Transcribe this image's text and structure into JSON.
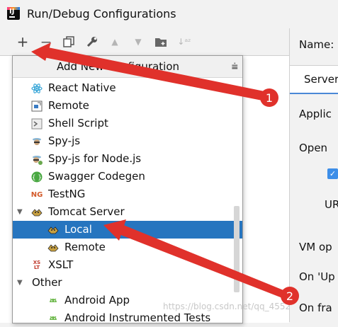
{
  "window": {
    "title": "Run/Debug Configurations"
  },
  "toolbar": {
    "icons": [
      "plus-icon",
      "minus-icon",
      "copy-icon",
      "wrench-icon",
      "arrow-up-icon",
      "arrow-down-icon",
      "folder-icon",
      "sort-icon"
    ]
  },
  "popup": {
    "title": "Add New Configuration",
    "items": [
      {
        "label": "React Native",
        "icon": "react-icon"
      },
      {
        "label": "Remote",
        "icon": "remote-icon"
      },
      {
        "label": "Shell Script",
        "icon": "shell-icon"
      },
      {
        "label": "Spy-js",
        "icon": "spy-icon"
      },
      {
        "label": "Spy-js for Node.js",
        "icon": "spy-node-icon"
      },
      {
        "label": "Swagger Codegen",
        "icon": "swagger-icon"
      },
      {
        "label": "TestNG",
        "icon": "testng-icon"
      },
      {
        "label": "Tomcat Server",
        "icon": "tomcat-icon",
        "expanded": true
      },
      {
        "label": "Local",
        "icon": "tomcat-icon",
        "selected": true
      },
      {
        "label": "Remote",
        "icon": "tomcat-icon"
      },
      {
        "label": "XSLT",
        "icon": "xslt-icon"
      },
      {
        "label": "Other",
        "expanded": true
      },
      {
        "label": "Android App",
        "icon": "android-icon"
      },
      {
        "label": "Android Instrumented Tests",
        "icon": "android-icon"
      }
    ]
  },
  "right": {
    "name_label": "Name:",
    "server_tab": "Server",
    "fragments": [
      "Applic",
      "Open",
      "UR",
      "VM op",
      "On 'Up",
      "On fra"
    ]
  },
  "annotations": {
    "one": "1",
    "two": "2"
  },
  "watermark": "https://blog.csdn.net/qq_4552"
}
